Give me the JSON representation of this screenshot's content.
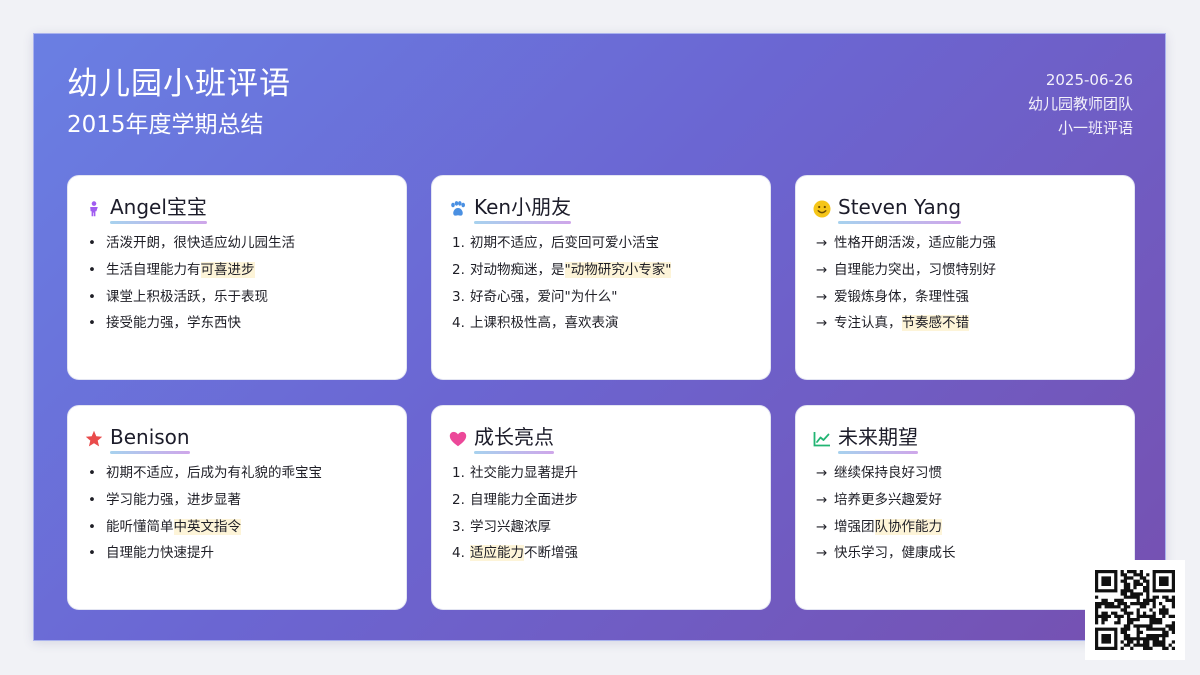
{
  "header": {
    "title": "幼儿园小班评语",
    "subtitle": "2015年度学期总结",
    "date": "2025-06-26",
    "team": "幼儿园教师团队",
    "class_name": "小一班评语"
  },
  "cards": [
    {
      "title": "Angel宝宝",
      "icon": "child-icon",
      "items": [
        {
          "pre": "活泼开朗，很快适应幼儿园生活",
          "hl": "",
          "post": ""
        },
        {
          "pre": "生活自理能力有",
          "hl": "可喜进步",
          "post": ""
        },
        {
          "pre": "课堂上积极活跃，乐于表现",
          "hl": "",
          "post": ""
        },
        {
          "pre": "接受能力强，学东西快",
          "hl": "",
          "post": ""
        }
      ]
    },
    {
      "title": "Ken小朋友",
      "icon": "paw-icon",
      "items": [
        {
          "pre": "初期不适应，后变回可爱小活宝",
          "hl": "",
          "post": ""
        },
        {
          "pre": "对动物痴迷，是",
          "hl": "\"动物研究小专家\"",
          "post": ""
        },
        {
          "pre": "好奇心强，爱问\"为什么\"",
          "hl": "",
          "post": ""
        },
        {
          "pre": "上课积极性高，喜欢表演",
          "hl": "",
          "post": ""
        }
      ]
    },
    {
      "title": "Steven Yang",
      "icon": "smile-icon",
      "items": [
        {
          "pre": "性格开朗活泼，适应能力强",
          "hl": "",
          "post": ""
        },
        {
          "pre": "自理能力突出，习惯特别好",
          "hl": "",
          "post": ""
        },
        {
          "pre": "爱锻炼身体，条理性强",
          "hl": "",
          "post": ""
        },
        {
          "pre": "专注认真，",
          "hl": "节奏感不错",
          "post": ""
        }
      ]
    },
    {
      "title": "Benison",
      "icon": "star-icon",
      "items": [
        {
          "pre": "初期不适应，后成为有礼貌的乖宝宝",
          "hl": "",
          "post": ""
        },
        {
          "pre": "学习能力强，进步显著",
          "hl": "",
          "post": ""
        },
        {
          "pre": "能听懂简单",
          "hl": "中英文指令",
          "post": ""
        },
        {
          "pre": "自理能力快速提升",
          "hl": "",
          "post": ""
        }
      ]
    },
    {
      "title": "成长亮点",
      "icon": "heart-icon",
      "items": [
        {
          "pre": "社交能力显著提升",
          "hl": "",
          "post": ""
        },
        {
          "pre": "自理能力全面进步",
          "hl": "",
          "post": ""
        },
        {
          "pre": "学习兴趣浓厚",
          "hl": "",
          "post": ""
        },
        {
          "pre": "",
          "hl": "适应能力",
          "post": "不断增强"
        }
      ]
    },
    {
      "title": "未来期望",
      "icon": "line-chart-icon",
      "items": [
        {
          "pre": "继续保持良好习惯",
          "hl": "",
          "post": ""
        },
        {
          "pre": "培养更多兴趣爱好",
          "hl": "",
          "post": ""
        },
        {
          "pre": "增强团",
          "hl": "队协作能力",
          "post": ""
        },
        {
          "pre": "快乐学习，健康成长",
          "hl": "",
          "post": ""
        }
      ]
    }
  ],
  "markers": {
    "bullet": "•",
    "arrow": "→",
    "numbers": [
      "1.",
      "2.",
      "3.",
      "4."
    ]
  },
  "colors": {
    "gradient_start": "#6a7fe3",
    "gradient_end": "#7650b0",
    "child_icon": "#a05cf0",
    "paw_icon": "#4a90e2",
    "smile_icon": "#f5c518",
    "star_icon": "#e94b4b",
    "heart_icon": "#ec4899",
    "chart_icon": "#22b573",
    "highlight": "#fdf4d8"
  }
}
